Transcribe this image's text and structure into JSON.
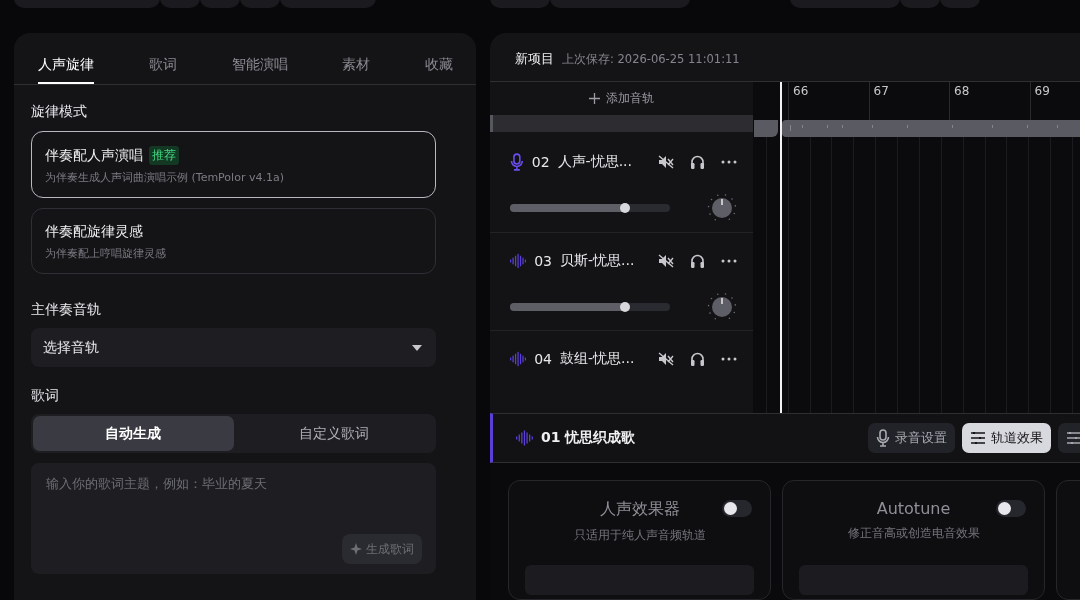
{
  "left_panel": {
    "tabs": [
      {
        "label": "人声旋律",
        "selected": true
      },
      {
        "label": "歌词",
        "selected": false
      },
      {
        "label": "智能演唱",
        "selected": false
      },
      {
        "label": "素材",
        "selected": false
      },
      {
        "label": "收藏",
        "selected": false
      }
    ],
    "melody_mode": {
      "label": "旋律模式",
      "options": [
        {
          "title": "伴奏配人声演唱",
          "badge": "推荐",
          "description": "为伴奏生成人声词曲演唱示例 (TemPolor v4.1a)",
          "selected": true
        },
        {
          "title": "伴奏配旋律灵感",
          "description": "为伴奏配上哼唱旋律灵感",
          "selected": false
        }
      ]
    },
    "main_track": {
      "label": "主伴奏音轨",
      "value": "选择音轨"
    },
    "lyrics": {
      "label": "歌词",
      "modes": [
        {
          "label": "自动生成",
          "selected": true
        },
        {
          "label": "自定义歌词",
          "selected": false
        }
      ],
      "placeholder": "输入你的歌词主题，例如：毕业的夏天",
      "generate_button": "生成歌词"
    }
  },
  "project": {
    "title": "新项目",
    "saved": "上次保存: 2026-06-25 11:01:11",
    "add_track": "添加音轨",
    "ruler": [
      "66",
      "67",
      "68",
      "69"
    ],
    "tracks": [
      {
        "kind": "mic",
        "number": "02",
        "name": "人声-忧思...",
        "level": 0.72
      },
      {
        "kind": "wave",
        "number": "03",
        "name": "贝斯-忧思...",
        "level": 0.72
      },
      {
        "kind": "wave",
        "number": "04",
        "name": "鼓组-忧思..."
      }
    ]
  },
  "track_panel": {
    "title": "01 忧思织成歌",
    "buttons": [
      {
        "kind": "mic",
        "label": "录音设置",
        "selected": false
      },
      {
        "kind": "fx",
        "label": "轨道效果",
        "selected": true
      },
      {
        "kind": "fx",
        "selected": false
      }
    ],
    "effects": [
      {
        "title": "人声效果器",
        "description": "只适用于纯人声音频轨道",
        "on": false
      },
      {
        "title": "Autotune",
        "description": "修正音高或创造电音效果",
        "on": false
      }
    ]
  }
}
